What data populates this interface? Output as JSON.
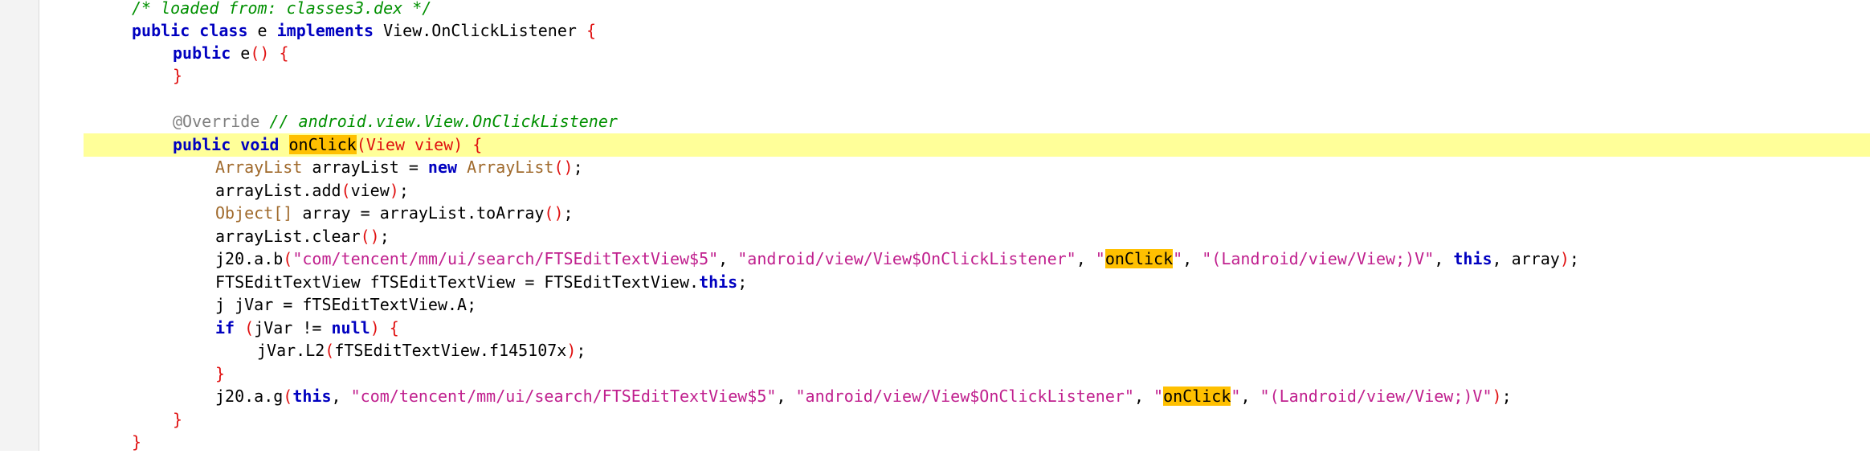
{
  "editor": {
    "lines": [
      {
        "tokens": [
          {
            "t": "/* loaded from: classes3.dex */",
            "c": "cm"
          }
        ]
      },
      {
        "tokens": [
          {
            "t": "public class",
            "c": "kw"
          },
          {
            "t": " e "
          },
          {
            "t": "implements",
            "c": "kw"
          },
          {
            "t": " View.OnClickListener "
          },
          {
            "t": "{",
            "c": "br"
          }
        ]
      },
      {
        "tokens": [
          {
            "t": "public",
            "c": "kw"
          },
          {
            "t": " e"
          },
          {
            "t": "()",
            "c": "br"
          },
          {
            "t": " "
          },
          {
            "t": "{",
            "c": "br"
          }
        ]
      },
      {
        "tokens": [
          {
            "t": "}",
            "c": "br"
          }
        ]
      },
      {
        "tokens": []
      },
      {
        "tokens": [
          {
            "t": "@Override",
            "c": "an"
          },
          {
            "t": " "
          },
          {
            "t": "// android.view.View.OnClickListener",
            "c": "cm"
          }
        ]
      },
      {
        "current": true,
        "tokens": [
          {
            "t": "public void",
            "c": "kw"
          },
          {
            "t": " "
          },
          {
            "t": "onClick",
            "c": "hl"
          },
          {
            "t": "(View view)",
            "c": "br"
          },
          {
            "t": " "
          },
          {
            "t": "{",
            "c": "br"
          }
        ]
      },
      {
        "tokens": [
          {
            "t": "ArrayList",
            "c": "ty"
          },
          {
            "t": " arrayList = "
          },
          {
            "t": "new",
            "c": "kw"
          },
          {
            "t": " "
          },
          {
            "t": "ArrayList",
            "c": "ty"
          },
          {
            "t": "()",
            "c": "br"
          },
          {
            "t": ";"
          }
        ]
      },
      {
        "tokens": [
          {
            "t": "arrayList.add"
          },
          {
            "t": "(",
            "c": "br"
          },
          {
            "t": "view"
          },
          {
            "t": ")",
            "c": "br"
          },
          {
            "t": ";"
          }
        ]
      },
      {
        "tokens": [
          {
            "t": "Object[]",
            "c": "ty"
          },
          {
            "t": " array = arrayList.toArray"
          },
          {
            "t": "()",
            "c": "br"
          },
          {
            "t": ";"
          }
        ]
      },
      {
        "tokens": [
          {
            "t": "arrayList.clear"
          },
          {
            "t": "()",
            "c": "br"
          },
          {
            "t": ";"
          }
        ]
      },
      {
        "tokens": [
          {
            "t": "j20.a.b"
          },
          {
            "t": "(",
            "c": "br"
          },
          {
            "t": "\"com/tencent/mm/ui/search/FTSEditTextView$5\"",
            "c": "str"
          },
          {
            "t": ", "
          },
          {
            "t": "\"android/view/View$OnClickListener\"",
            "c": "str"
          },
          {
            "t": ", "
          },
          {
            "t": "\"",
            "c": "str"
          },
          {
            "t": "onClick",
            "c": "hl"
          },
          {
            "t": "\"",
            "c": "str"
          },
          {
            "t": ", "
          },
          {
            "t": "\"(Landroid/view/View;)V\"",
            "c": "str"
          },
          {
            "t": ", "
          },
          {
            "t": "this",
            "c": "kw"
          },
          {
            "t": ", array"
          },
          {
            "t": ")",
            "c": "br"
          },
          {
            "t": ";"
          }
        ]
      },
      {
        "tokens": [
          {
            "t": "FTSEditTextView fTSEditTextView = FTSEditTextView."
          },
          {
            "t": "this",
            "c": "kw"
          },
          {
            "t": ";"
          }
        ]
      },
      {
        "tokens": [
          {
            "t": "j jVar = fTSEditTextView.A;"
          }
        ]
      },
      {
        "tokens": [
          {
            "t": "if",
            "c": "kw"
          },
          {
            "t": " "
          },
          {
            "t": "(",
            "c": "br"
          },
          {
            "t": "jVar != "
          },
          {
            "t": "null",
            "c": "kw"
          },
          {
            "t": ")",
            "c": "br"
          },
          {
            "t": " "
          },
          {
            "t": "{",
            "c": "br"
          }
        ]
      },
      {
        "tokens": [
          {
            "t": "jVar.L2"
          },
          {
            "t": "(",
            "c": "br"
          },
          {
            "t": "fTSEditTextView.f145107x"
          },
          {
            "t": ")",
            "c": "br"
          },
          {
            "t": ";"
          }
        ]
      },
      {
        "tokens": [
          {
            "t": "}",
            "c": "br"
          }
        ]
      },
      {
        "tokens": [
          {
            "t": "j20.a.g"
          },
          {
            "t": "(",
            "c": "br"
          },
          {
            "t": "this",
            "c": "kw"
          },
          {
            "t": ", "
          },
          {
            "t": "\"com/tencent/mm/ui/search/FTSEditTextView$5\"",
            "c": "str"
          },
          {
            "t": ", "
          },
          {
            "t": "\"android/view/View$OnClickListener\"",
            "c": "str"
          },
          {
            "t": ", "
          },
          {
            "t": "\"",
            "c": "str"
          },
          {
            "t": "onClick",
            "c": "hl"
          },
          {
            "t": "\"",
            "c": "str"
          },
          {
            "t": ", "
          },
          {
            "t": "\"(Landroid/view/View;)V\"",
            "c": "str"
          },
          {
            "t": ")",
            "c": "br"
          },
          {
            "t": ";"
          }
        ]
      },
      {
        "tokens": [
          {
            "t": "}",
            "c": "br"
          }
        ]
      },
      {
        "tokens": [
          {
            "t": "}",
            "c": "br"
          }
        ]
      }
    ]
  }
}
